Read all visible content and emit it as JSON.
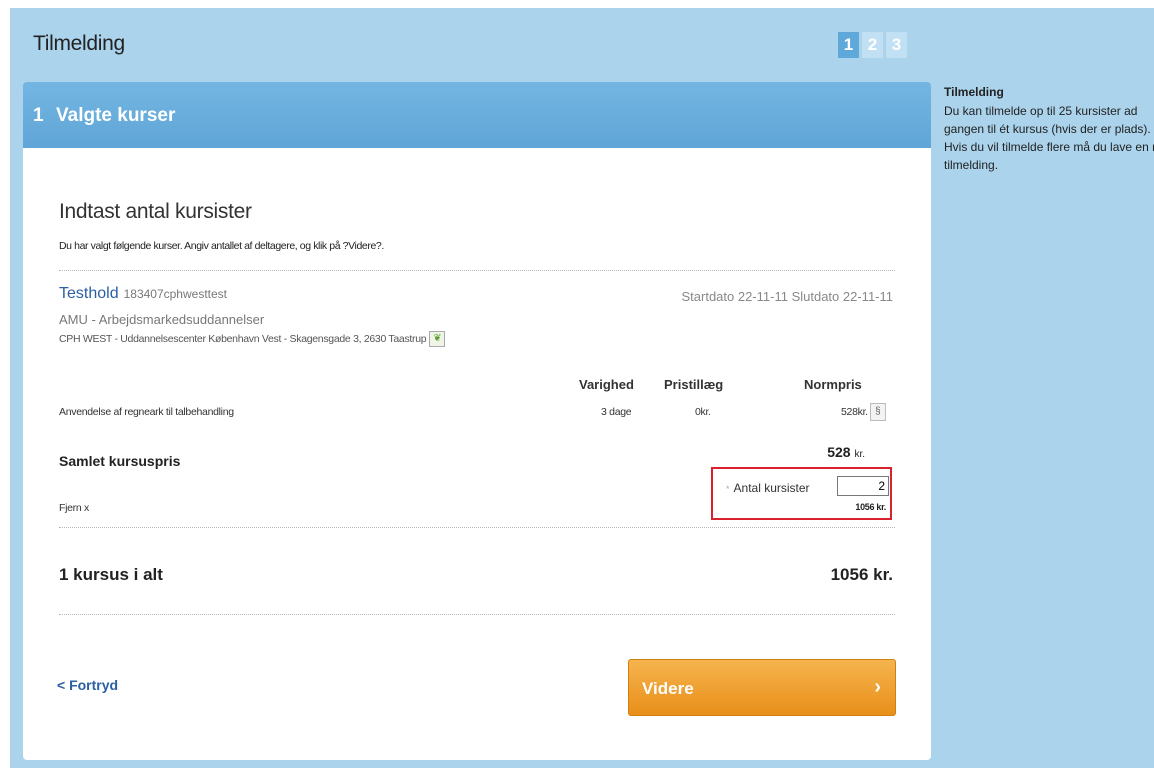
{
  "header": {
    "title": "Tilmelding",
    "steps": [
      "1",
      "2",
      "3"
    ]
  },
  "section": {
    "number": "1",
    "title": "Valgte kurser"
  },
  "panel": {
    "heading": "Indtast antal kursister",
    "intro": "Du har valgt følgende kurser. Angiv antallet af deltagere, og klik på ?Videre?."
  },
  "course": {
    "title": "Testhold",
    "code": "183407cphwesttest",
    "dates": "Startdato  22-11-11  Slutdato  22-11-11",
    "category": "AMU - Arbejdsmarkedsuddannelser",
    "address": "CPH WEST - Uddannelsescenter København Vest - Skagensgade 3, 2630 Taastrup",
    "columns": {
      "duration": "Varighed",
      "surcharge": "Pristillæg",
      "normal_price": "Normpris"
    },
    "row": {
      "name": "Anvendelse af regneark til talbehandling",
      "duration": "3 dage",
      "surcharge": "0kr.",
      "price": "528kr."
    },
    "total_label": "Samlet kursuspris",
    "total_value": "528",
    "total_unit": "kr.",
    "antal_label": "Antal kursister",
    "antal_value": "2",
    "antal_total": "1056 kr.",
    "remove": "Fjern x"
  },
  "summary": {
    "label": "1 kursus i alt",
    "total": "1056 kr."
  },
  "actions": {
    "cancel": "< Fortryd",
    "next": "Videre",
    "next_arrow": "›"
  },
  "sidebar": {
    "title": "Tilmelding",
    "text": "Du kan tilmelde op til 25 kursister ad gangen til ét kursus (hvis der er plads). Hvis du vil tilmelde flere må du lave en ny tilmelding."
  }
}
